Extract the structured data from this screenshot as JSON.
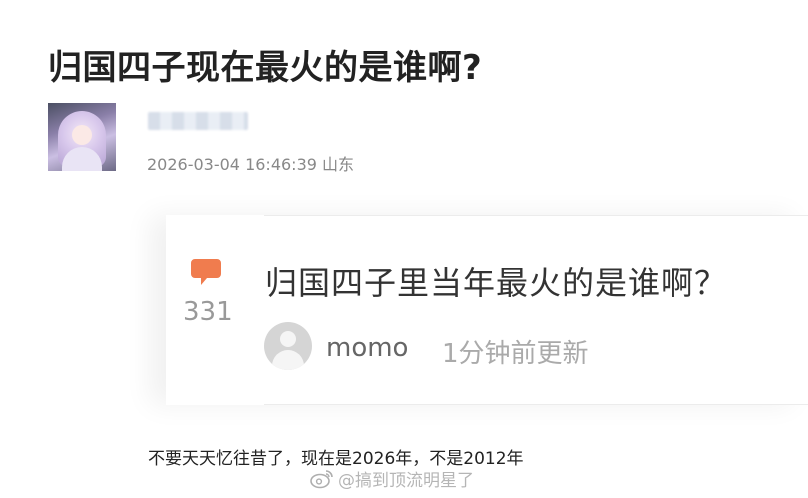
{
  "post": {
    "title": "归国四子现在最火的是谁啊?",
    "meta": "2026-03-04 16:46:39 山东"
  },
  "card": {
    "comment_count": "331",
    "question": "归国四子里当年最火的是谁啊？",
    "author": "momo",
    "updated": "1分钟前更新"
  },
  "comment": {
    "text": "不要天天忆往昔了，现在是2026年，不是2012年"
  },
  "watermark": {
    "text": "@搞到顶流明星了"
  },
  "colors": {
    "accent_icon": "#f07c4e",
    "title": "#222222",
    "meta": "#888888"
  },
  "icons": {
    "comment": "speech-bubble-icon",
    "watermark": "weibo-logo-icon"
  }
}
